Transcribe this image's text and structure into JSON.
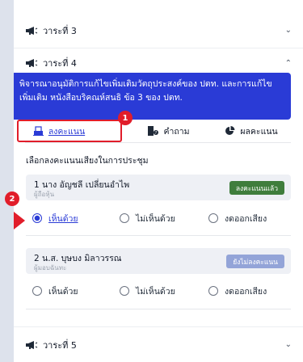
{
  "agenda_3": {
    "title": "วาระที่ 3"
  },
  "agenda_4": {
    "title": "วาระที่ 4",
    "description": "พิจารณาอนุมัติการแก้ไขเพิ่มเติมวัตถุประสงค์ของ ปตท. และการแก้ไขเพิ่มเติม หนังสือบริคณห์สนธิ ข้อ 3 ของ ปตท."
  },
  "tabs": [
    {
      "label": "ลงคะแนน",
      "icon": "ballot-box-icon"
    },
    {
      "label": "คำถาม",
      "icon": "question-icon"
    },
    {
      "label": "ผลคะแนน",
      "icon": "pie-chart-icon"
    }
  ],
  "markers": {
    "one": "1",
    "two": "2"
  },
  "section_title": "เลือกลงคะแนนเสียงในการประชุม",
  "voters": [
    {
      "name": "1 นาง อัญชลี เปลี่ยนอำไพ",
      "role": "ผู้ถือหุ้น",
      "status": "ลงคะแนนแล้ว",
      "options": [
        "เห็นด้วย",
        "ไม่เห็นด้วย",
        "งดออกเสียง"
      ],
      "selected": "เห็นด้วย"
    },
    {
      "name": "2 น.ส. บุษบง มิลาวรรณ",
      "role": "ผู้มอบฉันทะ",
      "status": "ยังไม่ลงคะแนน",
      "options": [
        "เห็นด้วย",
        "ไม่เห็นด้วย",
        "งดออกเสียง"
      ],
      "selected": ""
    }
  ],
  "agenda_5": {
    "title": "วาระที่ 5"
  },
  "colors": {
    "accent": "#2a3bd6",
    "highlight": "#e11d2a",
    "voted_badge": "#3f7d3c",
    "pending_badge": "#93a4d8"
  }
}
